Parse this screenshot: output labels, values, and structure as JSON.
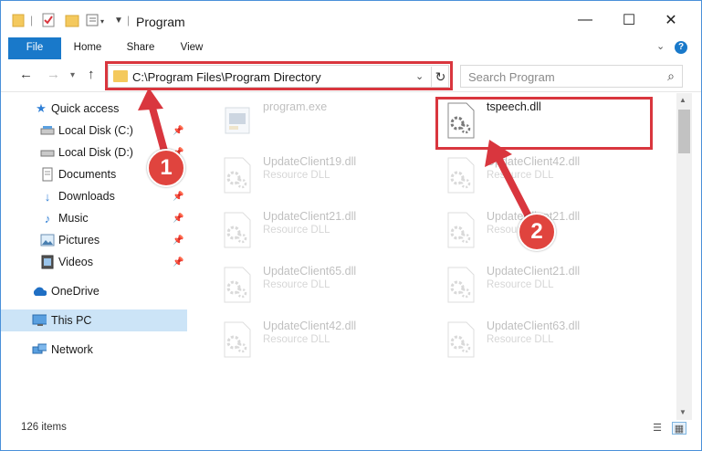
{
  "window": {
    "title": "Program",
    "controls": {
      "minimize": "—",
      "maximize": "☐",
      "close": "✕"
    }
  },
  "ribbon": {
    "tabs": [
      "File",
      "Home",
      "Share",
      "View"
    ],
    "help": "?"
  },
  "address_bar": {
    "path": "C:\\Program Files\\Program Directory",
    "search_placeholder": "Search Program"
  },
  "sidebar": {
    "items": [
      {
        "label": "Quick access",
        "icon": "star-icon",
        "pinned": false
      },
      {
        "label": "Local Disk (C:)",
        "icon": "drive-icon",
        "pinned": true
      },
      {
        "label": "Local Disk (D:)",
        "icon": "drive-icon",
        "pinned": true
      },
      {
        "label": "Documents",
        "icon": "documents-icon",
        "pinned": true
      },
      {
        "label": "Downloads",
        "icon": "download-icon",
        "pinned": true
      },
      {
        "label": "Music",
        "icon": "music-icon",
        "pinned": true
      },
      {
        "label": "Pictures",
        "icon": "pictures-icon",
        "pinned": true
      },
      {
        "label": "Videos",
        "icon": "videos-icon",
        "pinned": true
      },
      {
        "label": "OneDrive",
        "icon": "cloud-icon",
        "pinned": false
      },
      {
        "label": "This PC",
        "icon": "computer-icon",
        "pinned": false,
        "selected": true
      },
      {
        "label": "Network",
        "icon": "network-icon",
        "pinned": false
      }
    ]
  },
  "files": [
    {
      "name": "program.exe",
      "desc": "",
      "type": "exe",
      "faded": true
    },
    {
      "name": "tspeech.dll",
      "desc": "",
      "type": "dll",
      "faded": false,
      "highlighted": true
    },
    {
      "name": "UpdateClient19.dll",
      "desc": "Resource DLL",
      "type": "dll",
      "faded": true
    },
    {
      "name": "UpdateClient42.dll",
      "desc": "Resource DLL",
      "type": "dll",
      "faded": true
    },
    {
      "name": "UpdateClient21.dll",
      "desc": "Resource DLL",
      "type": "dll",
      "faded": true
    },
    {
      "name": "UpdateClient21.dll",
      "desc": "Resource DLL",
      "type": "dll",
      "faded": true
    },
    {
      "name": "UpdateClient65.dll",
      "desc": "Resource DLL",
      "type": "dll",
      "faded": true
    },
    {
      "name": "UpdateClient21.dll",
      "desc": "Resource DLL",
      "type": "dll",
      "faded": true
    },
    {
      "name": "UpdateClient42.dll",
      "desc": "Resource DLL",
      "type": "dll",
      "faded": true
    },
    {
      "name": "UpdateClient63.dll",
      "desc": "Resource DLL",
      "type": "dll",
      "faded": true
    }
  ],
  "status": {
    "item_count": "126 items"
  },
  "annotations": {
    "step1": "1",
    "step2": "2",
    "color": "#d9363e"
  }
}
